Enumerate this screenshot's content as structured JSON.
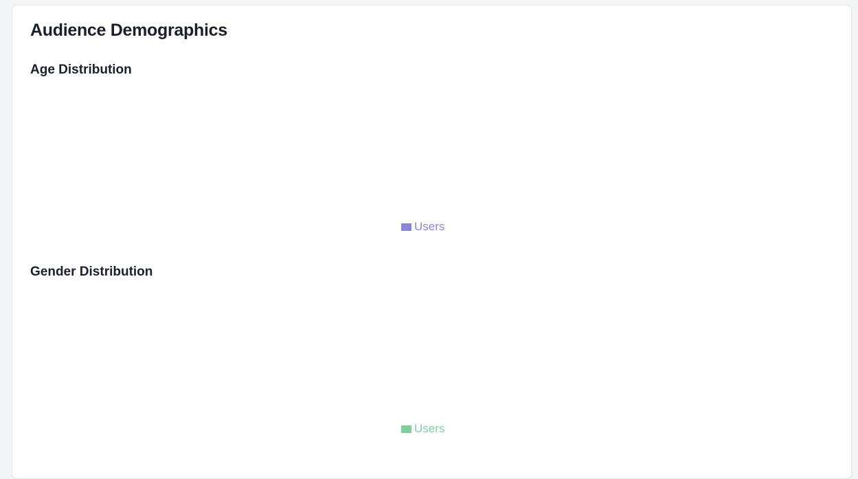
{
  "card": {
    "title": "Audience Demographics"
  },
  "age": {
    "title": "Age Distribution",
    "legend_label": "Users",
    "color": "#8b85dc"
  },
  "gender": {
    "title": "Gender Distribution",
    "legend_label": "Users",
    "color": "#7fcf9c"
  },
  "chart_data": [
    {
      "type": "bar",
      "title": "Age Distribution",
      "series": [
        {
          "name": "Users",
          "values": []
        }
      ],
      "categories": []
    },
    {
      "type": "bar",
      "title": "Gender Distribution",
      "series": [
        {
          "name": "Users",
          "values": []
        }
      ],
      "categories": []
    }
  ]
}
